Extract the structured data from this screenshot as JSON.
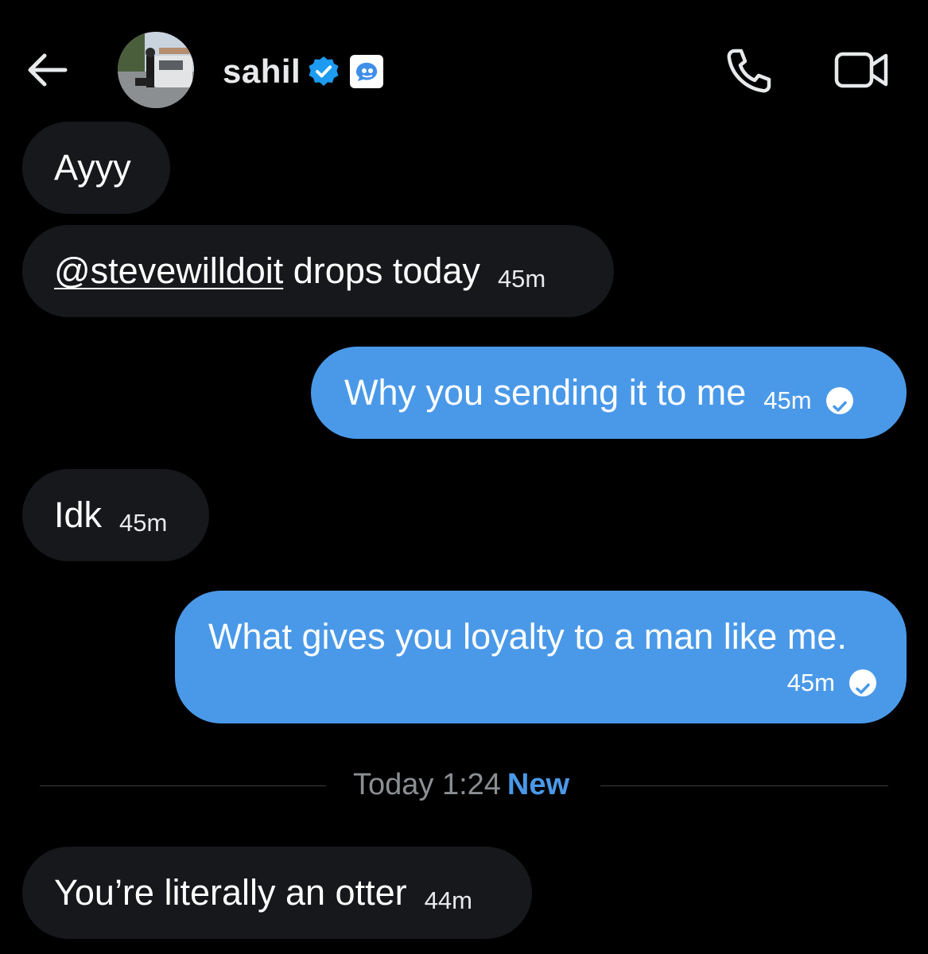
{
  "header": {
    "name": "sahil",
    "back_icon": "back-arrow-icon",
    "verified_icon": "verified-badge-icon",
    "affiliate_icon": "affiliate-badge-icon",
    "call_icon": "phone-icon",
    "video_icon": "video-camera-icon",
    "colors": {
      "verified": "#1d9bf0",
      "accent": "#4a99e9"
    }
  },
  "messages": [
    {
      "direction": "incoming",
      "text": "Ayyy",
      "time": ""
    },
    {
      "direction": "incoming",
      "mention": "@stevewilldoit",
      "text": " drops today",
      "time": "45m"
    },
    {
      "direction": "outgoing",
      "text": "Why you sending it to me",
      "time": "45m",
      "status_icon": "read-check-icon"
    },
    {
      "direction": "incoming",
      "text": "Idk",
      "time": "45m"
    },
    {
      "direction": "outgoing",
      "text": "What gives you loyalty to a man like me.",
      "time": "45m",
      "status_icon": "read-check-icon"
    },
    {
      "direction": "incoming",
      "text": "You’re literally an otter",
      "time": "44m"
    }
  ],
  "divider": {
    "time": "Today 1:24",
    "label": "New"
  }
}
